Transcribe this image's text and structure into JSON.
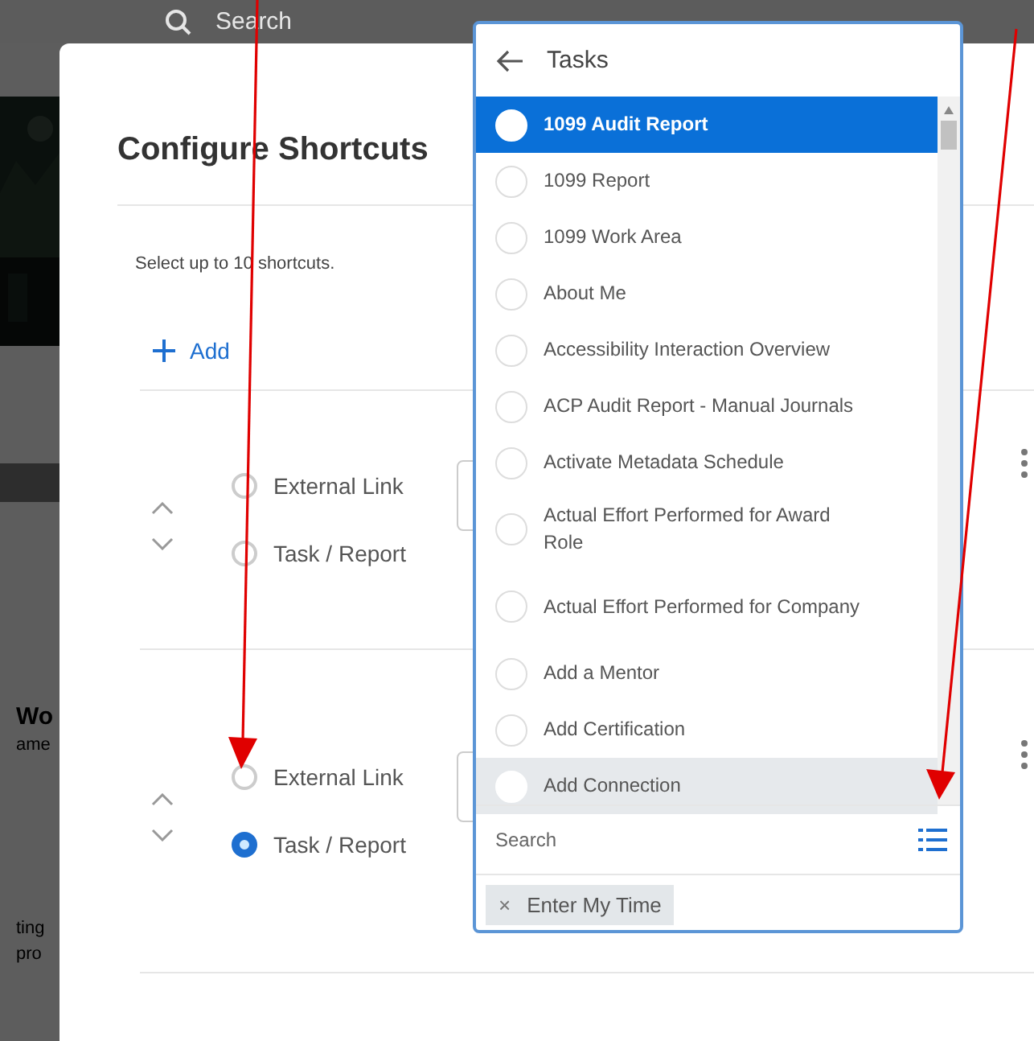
{
  "background": {
    "search_label": "Search",
    "fragments": [
      {
        "text": "Wo",
        "kind": "heading"
      },
      {
        "text": "ame",
        "kind": "line"
      },
      {
        "text": "ting",
        "kind": "line"
      },
      {
        "text": "pro",
        "kind": "line"
      }
    ]
  },
  "dialog": {
    "title": "Configure Shortcuts",
    "instruction": "Select up to 10 shortcuts.",
    "add_button": "Add",
    "shortcuts": [
      {
        "options": [
          {
            "label": "External Link",
            "selected": false
          },
          {
            "label": "Task / Report",
            "selected": false
          }
        ]
      },
      {
        "options": [
          {
            "label": "External Link",
            "selected": false
          },
          {
            "label": "Task / Report",
            "selected": true
          }
        ]
      }
    ]
  },
  "dropdown": {
    "title": "Tasks",
    "items": [
      {
        "label": "1099 Audit Report",
        "selected": true,
        "hovered": false
      },
      {
        "label": "1099 Report",
        "selected": false,
        "hovered": false
      },
      {
        "label": "1099 Work Area",
        "selected": false,
        "hovered": false
      },
      {
        "label": "About Me",
        "selected": false,
        "hovered": false
      },
      {
        "label": "Accessibility Interaction Overview",
        "selected": false,
        "hovered": false
      },
      {
        "label": "ACP Audit Report - Manual Journals",
        "selected": false,
        "hovered": false
      },
      {
        "label": "Activate Metadata Schedule",
        "selected": false,
        "hovered": false
      },
      {
        "label": "Actual Effort Performed for Award Role",
        "selected": false,
        "hovered": false
      },
      {
        "label": "Actual Effort Performed for Company",
        "selected": false,
        "hovered": false
      },
      {
        "label": "Add a Mentor",
        "selected": false,
        "hovered": false
      },
      {
        "label": "Add Certification",
        "selected": false,
        "hovered": false
      },
      {
        "label": "Add Connection",
        "selected": false,
        "hovered": true
      }
    ],
    "search": {
      "placeholder": "Search"
    },
    "chips": [
      {
        "label": "Enter My Time",
        "remove_icon": "×"
      }
    ]
  },
  "annotations": [
    {
      "kind": "arrow"
    },
    {
      "kind": "arrow"
    }
  ]
}
